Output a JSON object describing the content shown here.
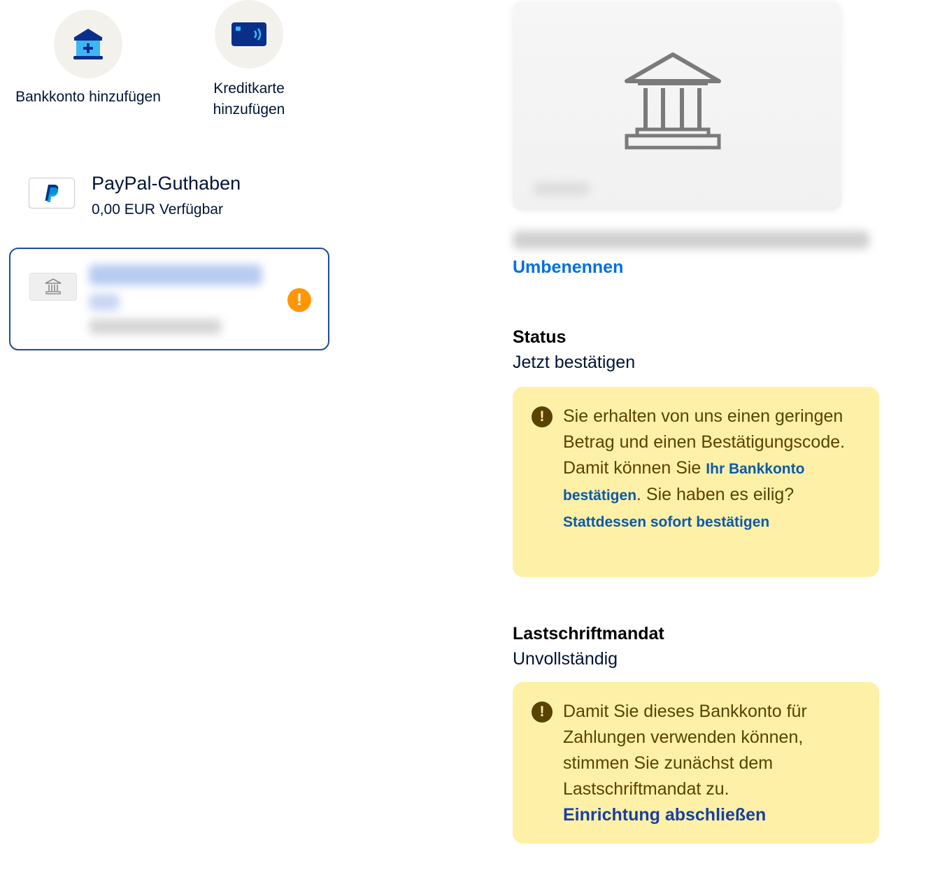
{
  "quick_actions": {
    "add_bank": {
      "label": "Bankkonto hinzufügen"
    },
    "add_card": {
      "label": "Kreditkarte\nhinzufügen"
    }
  },
  "balance": {
    "title": "PayPal-Guthaben",
    "amount": "0,00 EUR Verfügbar"
  },
  "detail": {
    "rename_link": "Umbenennen",
    "status": {
      "title": "Status",
      "value": "Jetzt bestätigen",
      "notice": {
        "text_1": "Sie erhalten von uns einen geringen Betrag und einen Bestätigungscode. Damit können Sie ",
        "link_1": "Ihr Bankkonto bestätigen",
        "text_2": ". Sie haben es eilig? ",
        "link_2": "Stattdessen sofort bestätigen"
      }
    },
    "mandate": {
      "title": "Lastschriftmandat",
      "value": "Unvollständig",
      "notice": {
        "text": "Damit Sie dieses Bankkonto für Zahlungen verwenden können, stimmen Sie zunächst dem Lastschriftmandat zu.",
        "link": "Einrichtung abschließen"
      }
    }
  },
  "colors": {
    "brand_dark": "#001435",
    "link_blue": "#0070e0",
    "selected_border": "#1f4aa0",
    "warning_orange": "#ff9600",
    "notice_bg": "#fff0a8",
    "notice_text": "#5a4200"
  },
  "icons": {
    "add_bank": "bank-plus-icon",
    "add_card": "contactless-card-icon",
    "paypal": "paypal-logo",
    "bank": "bank-building-icon",
    "warning": "exclamation-icon"
  }
}
